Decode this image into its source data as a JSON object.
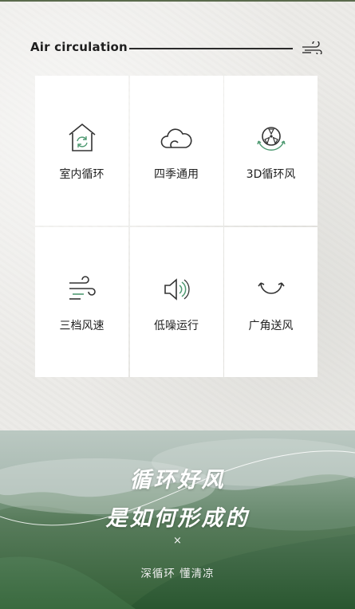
{
  "header": {
    "title": "Air circulation",
    "icon": "wind-icon"
  },
  "features": [
    {
      "icon": "house-circulation-icon",
      "label": "室内循环"
    },
    {
      "icon": "cloud-icon",
      "label": "四季通用"
    },
    {
      "icon": "fan-3d-icon",
      "label": "3D循环风"
    },
    {
      "icon": "wind-speed-icon",
      "label": "三档风速"
    },
    {
      "icon": "speaker-icon",
      "label": "低噪运行"
    },
    {
      "icon": "wide-angle-icon",
      "label": "广角送风"
    }
  ],
  "banner": {
    "headline_line1": "循环好风",
    "headline_line2": "是如何形成的",
    "separator": "×",
    "subtitle": "深循环 懂清凉"
  },
  "colors": {
    "accent_green": "#4f9a72",
    "icon_stroke": "#333333"
  }
}
